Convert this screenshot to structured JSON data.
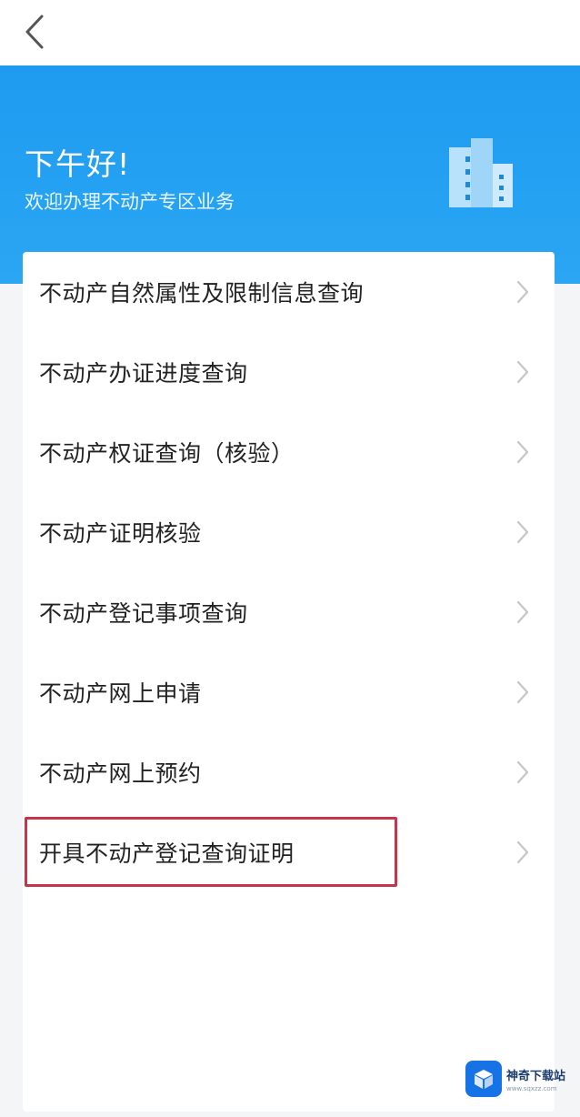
{
  "header": {
    "greeting": "下午好!",
    "subtitle": "欢迎办理不动产专区业务",
    "hero_color": "#1e9bf0"
  },
  "menu": {
    "items": [
      {
        "label": "不动产自然属性及限制信息查询"
      },
      {
        "label": "不动产办证进度查询"
      },
      {
        "label": "不动产权证查询（核验）"
      },
      {
        "label": "不动产证明核验"
      },
      {
        "label": "不动产登记事项查询"
      },
      {
        "label": "不动产网上申请"
      },
      {
        "label": "不动产网上预约"
      },
      {
        "label": "开具不动产登记查询证明"
      }
    ],
    "highlight_color": "#c8344a"
  },
  "watermark": {
    "title": "神奇下载站",
    "url": "www.sqxzz.com"
  },
  "icons": [
    "back-arrow-icon",
    "building-icon",
    "chevron-right-icon"
  ]
}
